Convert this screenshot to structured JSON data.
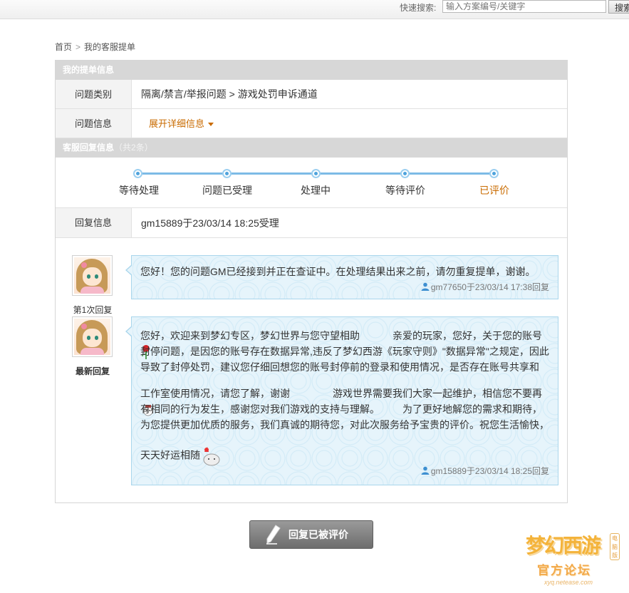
{
  "topbar": {
    "quick_search_label": "快速搜索:",
    "search_placeholder": "输入方案编号/关键字",
    "search_button": "搜索"
  },
  "breadcrumb": {
    "home": "首页",
    "separator": ">",
    "current": "我的客服提单"
  },
  "ticket_section": {
    "title": "我的提单信息",
    "rows": [
      {
        "label": "问题类别",
        "value": "隔离/禁言/举报问题 > 游戏处罚申诉通道"
      },
      {
        "label": "问题信息",
        "toggle": "展开详细信息"
      }
    ]
  },
  "reply_section": {
    "title": "客服回复信息",
    "count": "（共2条）",
    "progress": {
      "steps": [
        "等待处理",
        "问题已受理",
        "处理中",
        "等待评价",
        "已评价"
      ],
      "active_index": 4,
      "active_color": "#c96b00"
    },
    "reply_row": {
      "label": "回复信息",
      "value": "gm15889于23/03/14 18:25受理"
    }
  },
  "conversation": [
    {
      "avatar_label": "第1次回复",
      "text": "您好！您的问题GM已经接到并正在查证中。在处理结果出来之前，请勿重复提单，谢谢。",
      "signature": "gm77650于23/03/14 17:38回复"
    },
    {
      "avatar_label": "最新回复",
      "paragraphs": [
        "您好，欢迎来到梦幻专区，梦幻世界与您守望相助",
        "亲爱的玩家，您好，关于您的账号封停问题，是因您的账号存在数据异常,违反了梦幻西游《玩家守则》\"数据异常\"之规定，因此导致了封停处罚，建议您仔细回想您的账号封停前的登录和使用情况，是否存在账号共享和",
        "工作室使用情况，请您了解，谢谢",
        "游戏世界需要我们大家一起维护，相信您不要再有相同的行为发生，感谢您对我们游戏的支持与理解。",
        "为了更好地解您的需求和期待，为您提供更加优质的服务，我们真诚的期待您，对此次服务给予宝贵的评价。祝您生活愉快，",
        "天天好运相随"
      ],
      "signature": "gm15889于23/03/14 18:25回复"
    }
  ],
  "bottom_button": "回复已被评价",
  "watermark": {
    "title": "梦幻西游",
    "subtitle": "官方论坛",
    "url": "xyq.netease.com",
    "badge": "电脑版"
  }
}
